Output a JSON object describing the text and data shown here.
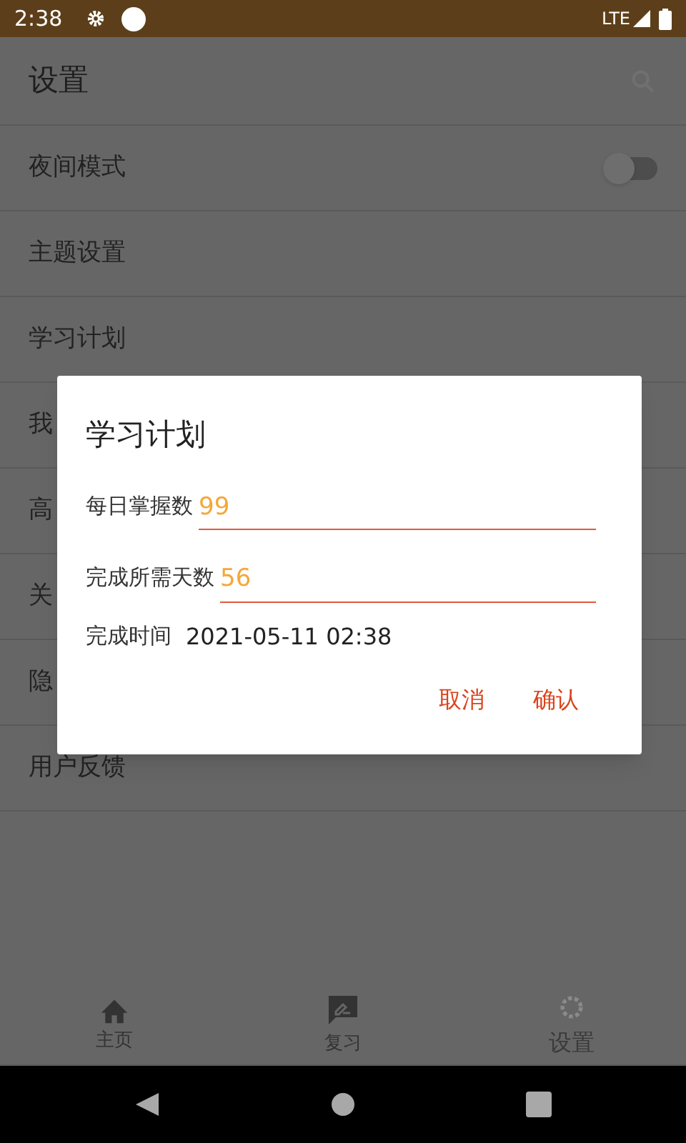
{
  "status_bar": {
    "time": "2:38",
    "network": "LTE"
  },
  "app_bar": {
    "title": "设置"
  },
  "settings": [
    {
      "kind": "switch",
      "label": "夜间模式",
      "on": false
    },
    {
      "kind": "link",
      "label": "主题设置"
    },
    {
      "kind": "link",
      "label": "学习计划"
    },
    {
      "kind": "link",
      "label": "我"
    },
    {
      "kind": "link",
      "label": "高"
    },
    {
      "kind": "link",
      "label": "关"
    },
    {
      "kind": "link",
      "label": "隐"
    },
    {
      "kind": "link",
      "label": "用户反馈"
    }
  ],
  "dialog": {
    "title": "学习计划",
    "fields": [
      {
        "label": "每日掌握数",
        "value": "99"
      },
      {
        "label": "完成所需天数",
        "value": "56"
      }
    ],
    "finish_label": "完成时间",
    "finish_value": "2021-05-11 02:38",
    "buttons": [
      "取消",
      "确认"
    ]
  },
  "bottom_nav": [
    {
      "kind": "home",
      "label": "主页",
      "selected": false
    },
    {
      "kind": "review",
      "label": "复习",
      "selected": false
    },
    {
      "kind": "settings",
      "label": "设置",
      "selected": true
    }
  ]
}
